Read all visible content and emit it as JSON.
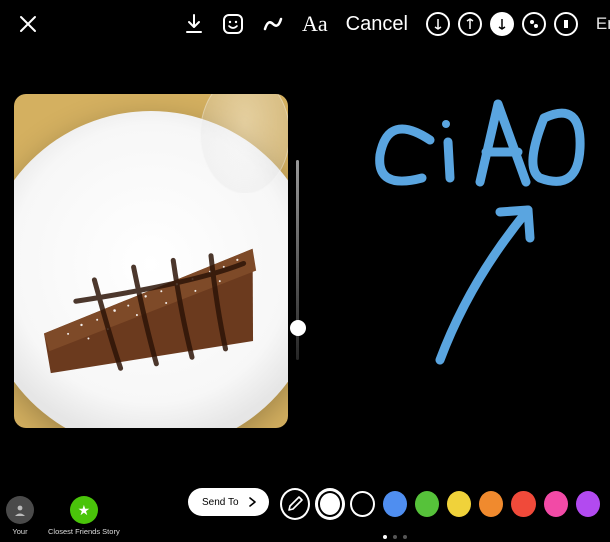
{
  "toolbar": {
    "text_tool": "Aa",
    "cancel": "Cancel",
    "right_cut": "End"
  },
  "handwriting": {
    "text": "CiAO",
    "color": "#5aa5e0"
  },
  "bottom": {
    "your_story": "Your",
    "close_friends": "Closest Friends Story",
    "send_to": "Send To"
  },
  "colors": {
    "selected_index": 1,
    "swatches": [
      "#ffffff",
      "#000000",
      "#4f8ef0",
      "#56c23a",
      "#f0d23a",
      "#f08a2e",
      "#f04a3a",
      "#f24aa6",
      "#b24af0"
    ]
  },
  "pager": {
    "count": 3,
    "active": 0
  }
}
